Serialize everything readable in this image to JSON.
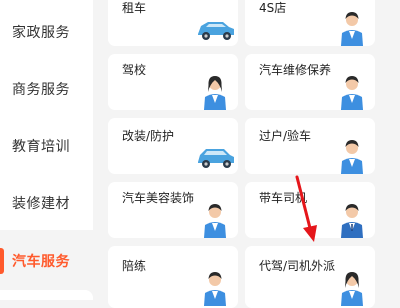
{
  "sidebar": {
    "categories": [
      {
        "label": "家政服务"
      },
      {
        "label": "商务服务"
      },
      {
        "label": "教育培训"
      },
      {
        "label": "装修建材"
      },
      {
        "label": "汽车服务",
        "active": true
      }
    ]
  },
  "services": [
    {
      "label": "租车",
      "image": "car-icon"
    },
    {
      "label": "4S店",
      "image": "staff-icon"
    },
    {
      "label": "驾校",
      "image": "staff-icon"
    },
    {
      "label": "汽车维修保养",
      "image": "staff-icon"
    },
    {
      "label": "改装/防护",
      "image": "car-icon"
    },
    {
      "label": "过户/验车",
      "image": "staff-icon"
    },
    {
      "label": "汽车美容装饰",
      "image": "staff-icon"
    },
    {
      "label": "带车司机",
      "image": "staff-icon"
    },
    {
      "label": "陪练",
      "image": "staff-icon"
    },
    {
      "label": "代驾/司机外派",
      "image": "staff-icon"
    }
  ],
  "colors": {
    "accent": "#ff5a2c",
    "annotation_arrow": "#e5161b",
    "car_blue": "#4aa3df",
    "uniform_blue": "#3d8fe0"
  }
}
